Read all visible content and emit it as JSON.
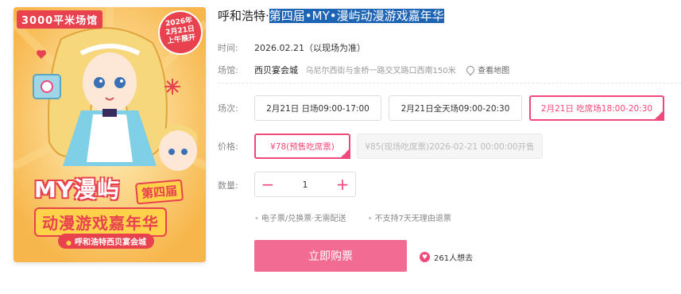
{
  "poster": {
    "top_title": "3000平米场馆",
    "date_badge": [
      "2026年",
      "2月21日",
      "上午展开"
    ],
    "event_main": "MY漫屿",
    "edition": "第四届",
    "subtitle": "动漫游戏嘉年华",
    "venue": "呼和浩特西贝宴会城"
  },
  "event": {
    "title_prefix": "呼和浩特·",
    "title_selected": "第四届•MY•漫屿动漫游戏嘉年华"
  },
  "info": {
    "time_label": "时间:",
    "time_value": "2026.02.21（以现场为准）",
    "venue_label": "场馆:",
    "venue_name": "西贝宴会城",
    "venue_address": "乌尼尔西街与金桥一路交叉路口西南150米",
    "map_link": "查看地图"
  },
  "sessions": {
    "label": "场次:",
    "options": [
      "2月21日 日场09:00-17:00",
      "2月21日全天场09:00-20:30",
      "2月21日 吃席场18:00-20:30"
    ],
    "selected_index": 2
  },
  "price": {
    "label": "价格:",
    "options": [
      "¥78(预售吃席票)",
      "¥85(现场吃席票)2026-02-21 00:00:00开售"
    ]
  },
  "quantity": {
    "label": "数量:",
    "minus": "−",
    "value": "1",
    "plus": "+"
  },
  "notes": [
    "电子票/兑换票·无需配送",
    "不支持7天无理由退票"
  ],
  "buy_button": "立即购票",
  "want": {
    "text": "261人想去",
    "icon": "heart-icon"
  },
  "colors": {
    "accent": "#f0487a",
    "buy_button": "#f26b93",
    "selection": "#1e64b4"
  }
}
